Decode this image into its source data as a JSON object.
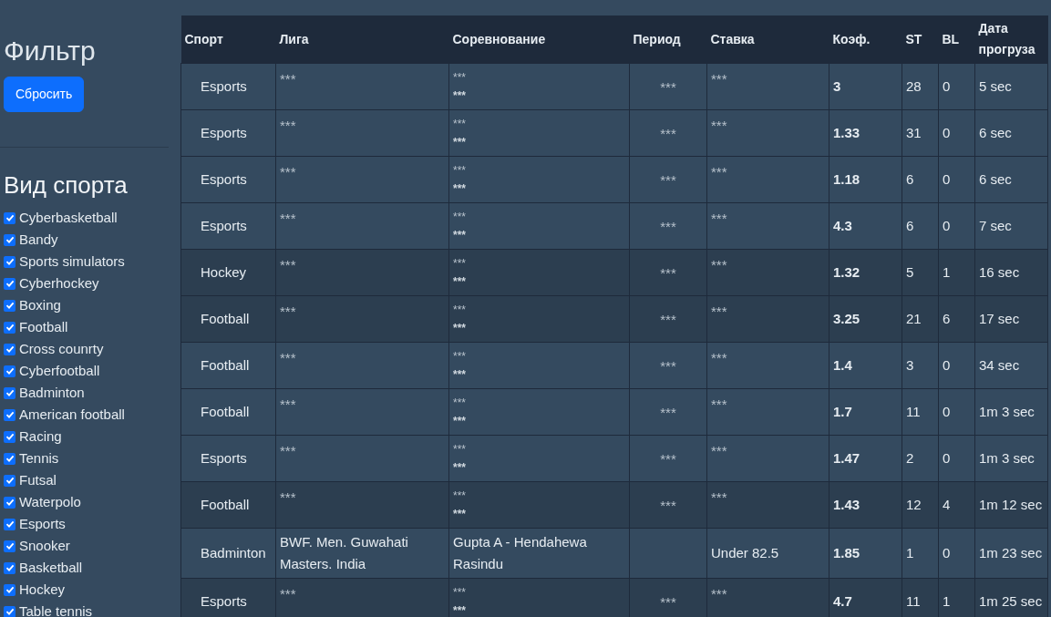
{
  "sidebar": {
    "title": "Фильтр",
    "reset_button": "Сбросить",
    "sport_heading": "Вид спорта",
    "sports": [
      {
        "label": "Cyberbasketball",
        "checked": true
      },
      {
        "label": "Bandy",
        "checked": true
      },
      {
        "label": "Sports simulators",
        "checked": true
      },
      {
        "label": "Cyberhockey",
        "checked": true
      },
      {
        "label": "Boxing",
        "checked": true
      },
      {
        "label": "Football",
        "checked": true
      },
      {
        "label": "Cross counrty",
        "checked": true
      },
      {
        "label": "Cyberfootball",
        "checked": true
      },
      {
        "label": "Badminton",
        "checked": true
      },
      {
        "label": "American football",
        "checked": true
      },
      {
        "label": "Racing",
        "checked": true
      },
      {
        "label": "Tennis",
        "checked": true
      },
      {
        "label": "Futsal",
        "checked": true
      },
      {
        "label": "Waterpolo",
        "checked": true
      },
      {
        "label": "Esports",
        "checked": true
      },
      {
        "label": "Snooker",
        "checked": true
      },
      {
        "label": "Basketball",
        "checked": true
      },
      {
        "label": "Hockey",
        "checked": true
      },
      {
        "label": "Table tennis",
        "checked": true
      }
    ]
  },
  "table": {
    "columns": [
      "Спорт",
      "Лига",
      "Соревнование",
      "Период",
      "Ставка",
      "Коэф.",
      "ST",
      "BL",
      "Дата прогруза"
    ],
    "rows": [
      {
        "sport": "Esports",
        "league": "***",
        "competition": {
          "text": "***",
          "detail": "***"
        },
        "period": "***",
        "bet": "***",
        "odds": "3",
        "st": "28",
        "bl": "0",
        "loaded": "5 sec",
        "masked": true,
        "highlighted": false
      },
      {
        "sport": "Esports",
        "league": "***",
        "competition": {
          "text": "***",
          "detail": "***"
        },
        "period": "***",
        "bet": "***",
        "odds": "1.33",
        "st": "31",
        "bl": "0",
        "loaded": "6 sec",
        "masked": true,
        "highlighted": false
      },
      {
        "sport": "Esports",
        "league": "***",
        "competition": {
          "text": "***",
          "detail": "***"
        },
        "period": "***",
        "bet": "***",
        "odds": "1.18",
        "st": "6",
        "bl": "0",
        "loaded": "6 sec",
        "masked": true,
        "highlighted": false
      },
      {
        "sport": "Esports",
        "league": "***",
        "competition": {
          "text": "***",
          "detail": "***"
        },
        "period": "***",
        "bet": "***",
        "odds": "4.3",
        "st": "6",
        "bl": "0",
        "loaded": "7 sec",
        "masked": true,
        "highlighted": false
      },
      {
        "sport": "Hockey",
        "league": "***",
        "competition": {
          "text": "***",
          "detail": "***"
        },
        "period": "***",
        "bet": "***",
        "odds": "1.32",
        "st": "5",
        "bl": "1",
        "loaded": "16 sec",
        "masked": true,
        "highlighted": true
      },
      {
        "sport": "Football",
        "league": "***",
        "competition": {
          "text": "***",
          "detail": "***"
        },
        "period": "***",
        "bet": "***",
        "odds": "3.25",
        "st": "21",
        "bl": "6",
        "loaded": "17 sec",
        "masked": true,
        "highlighted": true
      },
      {
        "sport": "Football",
        "league": "***",
        "competition": {
          "text": "***",
          "detail": "***"
        },
        "period": "***",
        "bet": "***",
        "odds": "1.4",
        "st": "3",
        "bl": "0",
        "loaded": "34 sec",
        "masked": true,
        "highlighted": false
      },
      {
        "sport": "Football",
        "league": "***",
        "competition": {
          "text": "***",
          "detail": "***"
        },
        "period": "***",
        "bet": "***",
        "odds": "1.7",
        "st": "11",
        "bl": "0",
        "loaded": "1m 3 sec",
        "masked": true,
        "highlighted": false
      },
      {
        "sport": "Esports",
        "league": "***",
        "competition": {
          "text": "***",
          "detail": "***"
        },
        "period": "***",
        "bet": "***",
        "odds": "1.47",
        "st": "2",
        "bl": "0",
        "loaded": "1m 3 sec",
        "masked": true,
        "highlighted": false
      },
      {
        "sport": "Football",
        "league": "***",
        "competition": {
          "text": "***",
          "detail": "***"
        },
        "period": "***",
        "bet": "***",
        "odds": "1.43",
        "st": "12",
        "bl": "4",
        "loaded": "1m 12 sec",
        "masked": true,
        "highlighted": true
      },
      {
        "sport": "Badminton",
        "league": "BWF. Men. Guwahati Masters. India",
        "competition": {
          "text": "Gupta A - Hendahewa Rasindu"
        },
        "bet": "Under 82.5",
        "odds": "1.85",
        "st": "1",
        "bl": "0",
        "loaded": "1m 23 sec",
        "masked": false,
        "highlighted": false
      },
      {
        "sport": "Esports",
        "league": "***",
        "competition": {
          "text": "***",
          "detail": "***"
        },
        "period": "***",
        "bet": "***",
        "odds": "4.7",
        "st": "11",
        "bl": "1",
        "loaded": "1m 25 sec",
        "masked": true,
        "highlighted": true
      }
    ]
  }
}
